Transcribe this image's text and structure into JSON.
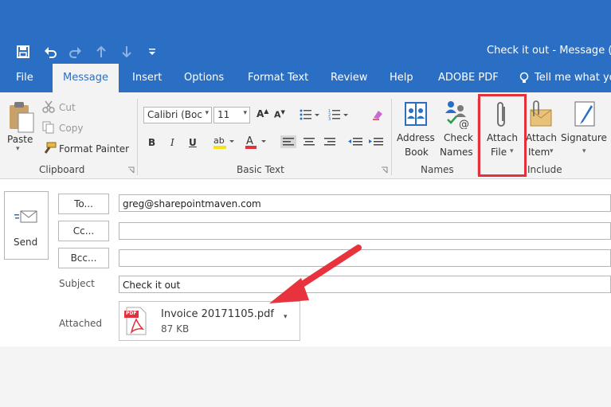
{
  "window": {
    "title": "Check it out  -  Message (H"
  },
  "qat": {
    "icons": [
      "save-icon",
      "undo-icon",
      "redo-icon",
      "up-arrow-icon",
      "down-arrow-icon",
      "customize-icon"
    ]
  },
  "tabs": [
    "File",
    "Message",
    "Insert",
    "Options",
    "Format Text",
    "Review",
    "Help",
    "ADOBE PDF",
    "Tell me what you"
  ],
  "ribbon": {
    "clipboard": {
      "paste": "Paste",
      "cut": "Cut",
      "copy": "Copy",
      "format_painter": "Format Painter",
      "group_label": "Clipboard"
    },
    "basic_text": {
      "font_name": "Calibri (Boc",
      "font_size": "11",
      "bold": "B",
      "italic": "I",
      "underline": "U",
      "group_label": "Basic Text"
    },
    "names": {
      "address_book_line1": "Address",
      "address_book_line2": "Book",
      "check_names_line1": "Check",
      "check_names_line2": "Names",
      "group_label": "Names"
    },
    "include": {
      "attach_file_line1": "Attach",
      "attach_file_line2": "File",
      "attach_item_line1": "Attach",
      "attach_item_line2": "Item",
      "signature": "Signature",
      "group_label": "Include"
    },
    "highlight_color": "#e2313b"
  },
  "compose": {
    "send": "Send",
    "to_button": "To...",
    "cc_button": "Cc...",
    "bcc_button": "Bcc...",
    "to_value": "greg@sharepointmaven.com",
    "cc_value": "",
    "bcc_value": "",
    "subject_label": "Subject",
    "subject_value": "Check it out",
    "attached_label": "Attached",
    "attachment": {
      "name": "Invoice 20171105.pdf",
      "size": "87 KB",
      "badge": "PDF"
    }
  },
  "annotation": {
    "arrow_color": "#e8333f"
  }
}
